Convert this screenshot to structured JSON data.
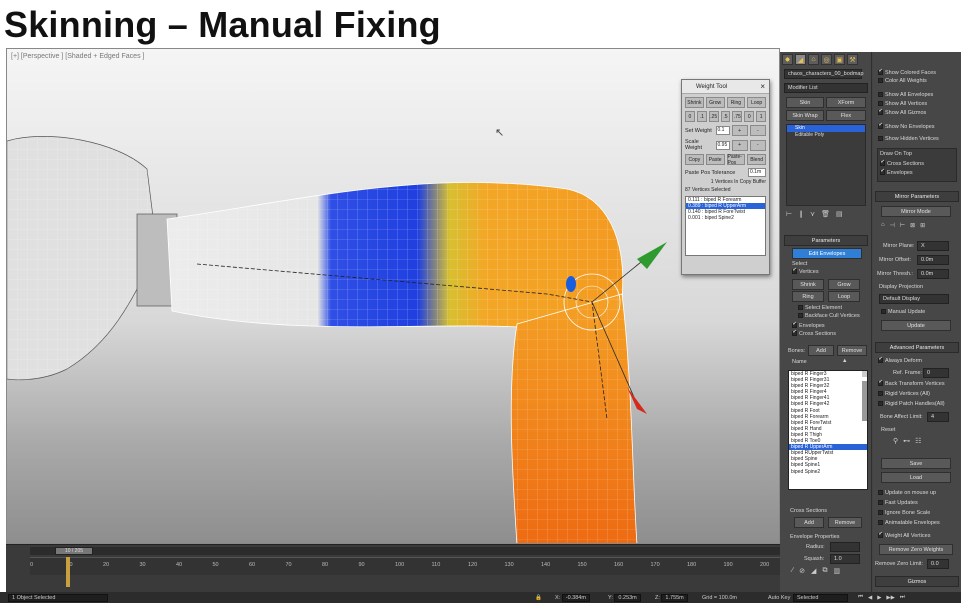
{
  "slide": {
    "title": "Skinning – Manual Fixing"
  },
  "viewport": {
    "label": "[+] [Perspective ] [Shaded + Edged Faces ]"
  },
  "weight_tool": {
    "title": "Weight Tool",
    "row1": [
      "Shrink",
      "Grow",
      "Ring",
      "Loop"
    ],
    "row2": [
      "0",
      ".1",
      ".25",
      ".5",
      ".75",
      "0",
      "1"
    ],
    "set_weight_label": "Set Weight",
    "set_weight_value": "0.1",
    "scale_weight_label": "Scale Weight",
    "scale_weight_value": "0.95",
    "row3": [
      "Copy",
      "Paste",
      "Paste-Pos",
      "Blend"
    ],
    "paste_pos_label": "Paste Pos Tolerance",
    "paste_pos_value": "0.1m",
    "copy_buffer_note": "1 Vertices In Copy Buffer",
    "selected_note": "87 Vertices Selected",
    "list": [
      {
        "text": "0.111 : biped R Forearm",
        "selected": false
      },
      {
        "text": "0.389 : biped R UpperArm",
        "selected": true
      },
      {
        "text": "0.140 : biped R ForeTwist",
        "selected": false
      },
      {
        "text": "0.001 : biped Spine2",
        "selected": false
      }
    ]
  },
  "command_panel": {
    "object_name": "chaos_characters_00_bodmap",
    "modifier_list": "Modifier List",
    "buttons_a": [
      "Skin",
      "XForm",
      "Skin Wrap",
      "Flex"
    ],
    "stack": [
      {
        "text": "Skin",
        "selected": true
      },
      {
        "text": "Editable Poly",
        "selected": false
      }
    ],
    "parameters_title": "Parameters",
    "edit_envelopes": "Edit Envelopes",
    "select_label": "Select",
    "vertices": "Vertices",
    "shrink": "Shrink",
    "grow": "Grow",
    "ring": "Ring",
    "loop": "Loop",
    "select_element": "Select Element",
    "backface_cull": "Backface Cull Vertices",
    "envelopes": "Envelopes",
    "cross_sections": "Cross Sections",
    "bones_label": "Bones:",
    "add": "Add",
    "remove": "Remove",
    "name_label": "Name",
    "bones": [
      {
        "text": "biped R Finger3",
        "selected": false
      },
      {
        "text": "biped R Finger31",
        "selected": false
      },
      {
        "text": "biped R Finger32",
        "selected": false
      },
      {
        "text": "biped R Finger4",
        "selected": false
      },
      {
        "text": "biped R Finger41",
        "selected": false
      },
      {
        "text": "biped R Finger42",
        "selected": false
      },
      {
        "text": "biped R Foot",
        "selected": false
      },
      {
        "text": "biped R Forearm",
        "selected": false
      },
      {
        "text": "biped R ForeTwist",
        "selected": false
      },
      {
        "text": "biped R Hand",
        "selected": false
      },
      {
        "text": "biped R Thigh",
        "selected": false
      },
      {
        "text": "biped R Toe0",
        "selected": false
      },
      {
        "text": "biped R UpperArm",
        "selected": true
      },
      {
        "text": "biped RUpperTwist",
        "selected": false
      },
      {
        "text": "biped Spine",
        "selected": false
      },
      {
        "text": "biped Spine1",
        "selected": false
      },
      {
        "text": "biped Spine2",
        "selected": false
      }
    ],
    "cross_sections_label": "Cross Sections",
    "cs_add": "Add",
    "cs_remove": "Remove",
    "envelope_props": "Envelope Properties",
    "radius_label": "Radius:",
    "squash_label": "Squash:",
    "squash_value": "1.0",
    "display_options": [
      {
        "text": "Show Colored Faces",
        "on": true
      },
      {
        "text": "Color All Weights",
        "on": false
      },
      {
        "text": "Show All Envelopes",
        "on": false
      },
      {
        "text": "Show All Vertices",
        "on": false
      },
      {
        "text": "Show All Gizmos",
        "on": true
      },
      {
        "text": "Show No Envelopes",
        "on": true
      },
      {
        "text": "Show Hidden Vertices",
        "on": false
      }
    ],
    "draw_on_top": "Draw On Top",
    "draw_on_top_opts": [
      {
        "text": "Cross Sections",
        "on": true
      },
      {
        "text": "Envelopes",
        "on": true
      }
    ],
    "mirror_title": "Mirror Parameters",
    "mirror_mode": "Mirror Mode",
    "mirror_plane_label": "Mirror Plane:",
    "mirror_plane_value": "X",
    "mirror_offset_label": "Mirror Offset:",
    "mirror_offset_value": "0.0m",
    "mirror_thresh_label": "Mirror Thresh.:",
    "mirror_thresh_value": "0.0m",
    "display_projection": "Display Projection",
    "default_display": "Default Display",
    "manual_update": "Manual Update",
    "update": "Update",
    "advanced_title": "Advanced Parameters",
    "always_deform": "Always Deform",
    "ref_frame_label": "Ref. Frame:",
    "ref_frame_value": "0",
    "back_transform": "Back Transform Vertices",
    "rigid_vertices": "Rigid Vertices (All)",
    "rigid_patch": "Rigid Patch Handles(All)",
    "bone_affect_label": "Bone Affect Limit:",
    "bone_affect_value": "4",
    "reset_label": "Reset",
    "save": "Save",
    "load": "Load",
    "adv_opts": [
      {
        "text": "Update on mouse up",
        "on": false
      },
      {
        "text": "Fast Updates",
        "on": false
      },
      {
        "text": "Ignore Bone Scale",
        "on": false
      },
      {
        "text": "Animatable Envelopes",
        "on": false
      },
      {
        "text": "Weight All Vertices",
        "on": true
      }
    ],
    "remove_zero_weights": "Remove Zero Weights",
    "remove_zero_limit_label": "Remove Zero Limit:",
    "remove_zero_limit_value": "0.0",
    "gizmos": "Gizmos"
  },
  "timeline": {
    "frame_indicator": "10 / 205",
    "ticks": [
      "0",
      "10",
      "20",
      "30",
      "40",
      "50",
      "60",
      "70",
      "80",
      "90",
      "100",
      "110",
      "120",
      "130",
      "140",
      "150",
      "160",
      "170",
      "180",
      "190",
      "200"
    ]
  },
  "status": {
    "selection": "1 Object Selected",
    "x": "-0.384m",
    "y": "0.253m",
    "z": "1.755m",
    "grid": "Grid = 100.0m",
    "auto_key": "Auto Key",
    "selected": "Selected"
  }
}
